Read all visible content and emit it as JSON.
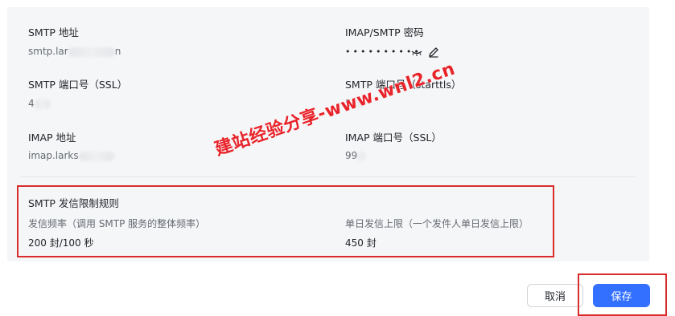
{
  "smtp_address": {
    "label": "SMTP 地址",
    "value_prefix": "smtp.lar",
    "value_suffix": "n"
  },
  "password": {
    "label": "IMAP/SMTP 密码",
    "masked": "••••••••••",
    "toggle_icon": "eye-closed-icon",
    "edit_icon": "pencil-icon"
  },
  "smtp_port_ssl": {
    "label": "SMTP 端口号（SSL）",
    "value": "4"
  },
  "smtp_port_starttls": {
    "label": "SMTP 端口号（starttls）",
    "value": "5"
  },
  "imap_address": {
    "label": "IMAP 地址",
    "value": "imap.larks"
  },
  "imap_port_ssl": {
    "label": "IMAP 端口号（SSL）",
    "value": "99"
  },
  "rate_limit": {
    "title": "SMTP 发信限制规则",
    "frequency_label": "发信频率（调用 SMTP 服务的整体频率）",
    "frequency_value": "200 封/100 秒",
    "daily_label": "单日发信上限（一个发件人单日发信上限）",
    "daily_value": "450 封"
  },
  "buttons": {
    "cancel": "取消",
    "save": "保存"
  },
  "watermark": "建站经验分享-www.wnl2.cn",
  "colors": {
    "primary": "#3370ff",
    "highlight": "#d92b2b",
    "watermark": "#e8242b"
  }
}
